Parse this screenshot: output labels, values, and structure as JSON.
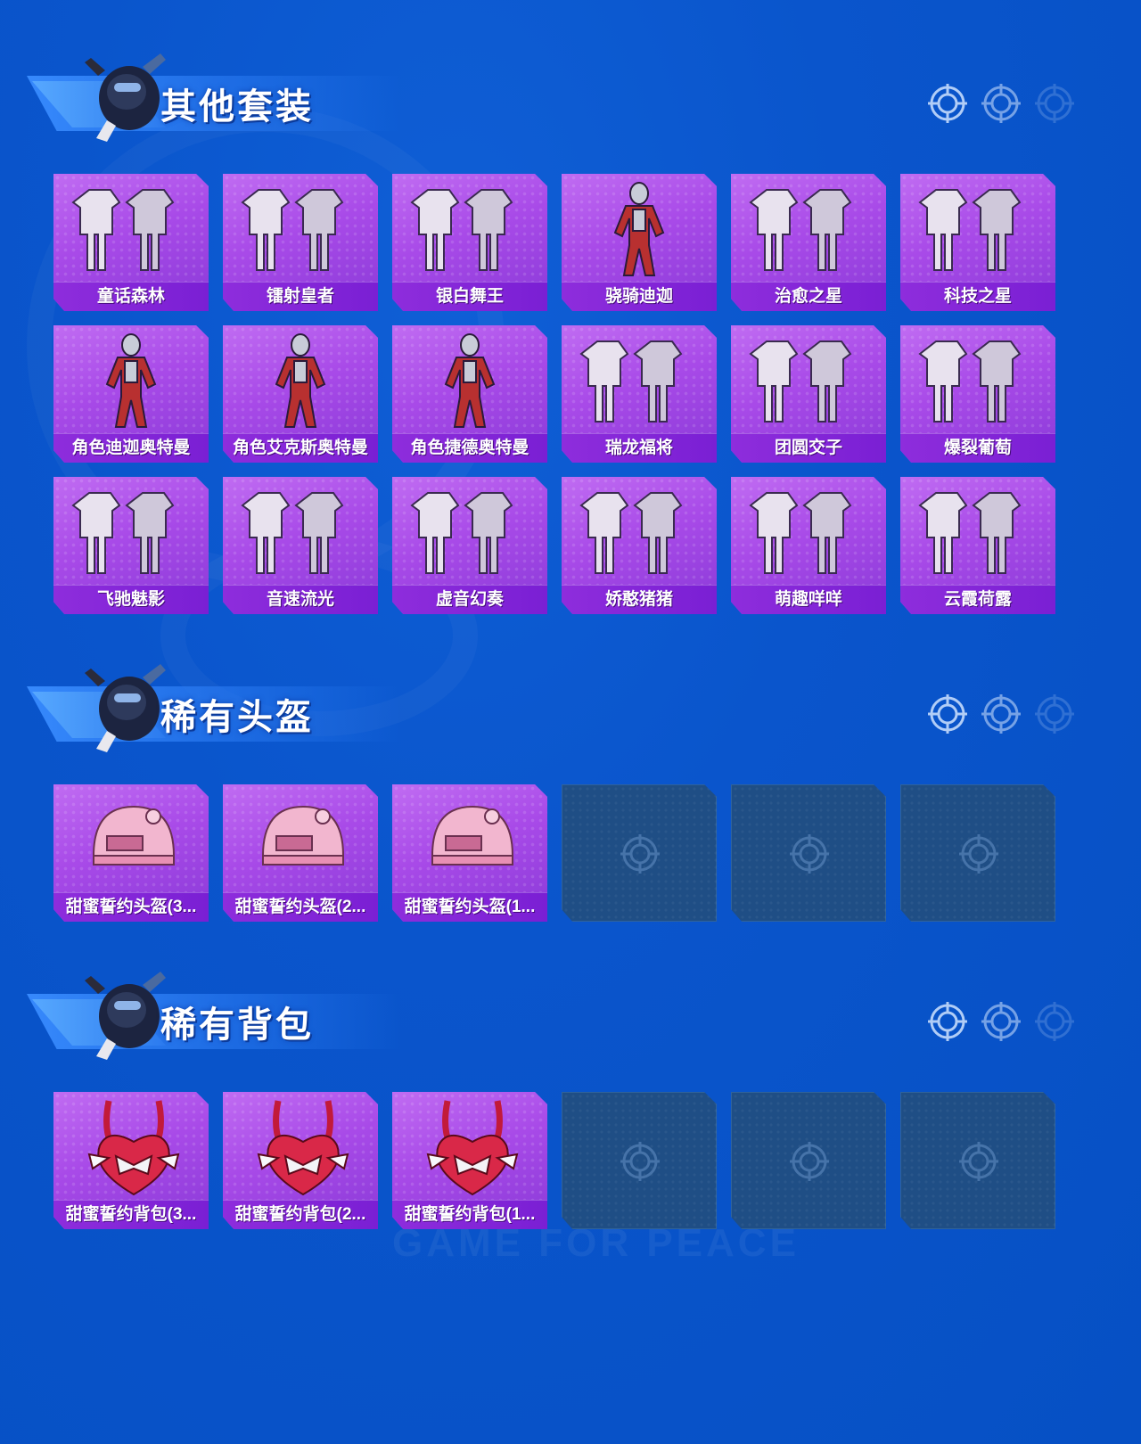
{
  "colors": {
    "background": "#0a55cc",
    "card_purple": "#a84ae8",
    "label_purple": "#8e2ddc",
    "empty_slot": "#1f4e85"
  },
  "watermark": "GAME FOR PEACE",
  "sections": [
    {
      "title": "其他套装",
      "items": [
        {
          "label": "童话森林",
          "art": "outfit-pair-icon"
        },
        {
          "label": "镭射皇者",
          "art": "outfit-pair-icon"
        },
        {
          "label": "银白舞王",
          "art": "outfit-pair-icon"
        },
        {
          "label": "骁骑迪迦",
          "art": "hero-figure-icon"
        },
        {
          "label": "治愈之星",
          "art": "outfit-pair-icon"
        },
        {
          "label": "科技之星",
          "art": "outfit-pair-icon"
        },
        {
          "label": "角色迪迦奥特曼",
          "art": "hero-figure-icon"
        },
        {
          "label": "角色艾克斯奥特曼",
          "art": "hero-figure-icon"
        },
        {
          "label": "角色捷德奥特曼",
          "art": "hero-figure-icon"
        },
        {
          "label": "瑞龙福将",
          "art": "outfit-pair-icon"
        },
        {
          "label": "团圆交子",
          "art": "outfit-pair-icon"
        },
        {
          "label": "爆裂葡萄",
          "art": "outfit-pair-icon"
        },
        {
          "label": "飞驰魅影",
          "art": "outfit-pair-icon"
        },
        {
          "label": "音速流光",
          "art": "outfit-pair-icon"
        },
        {
          "label": "虚音幻奏",
          "art": "outfit-pair-icon"
        },
        {
          "label": "娇憨猪猪",
          "art": "outfit-pair-icon"
        },
        {
          "label": "萌趣咩咩",
          "art": "outfit-pair-icon"
        },
        {
          "label": "云霞荷露",
          "art": "outfit-pair-icon"
        }
      ]
    },
    {
      "title": "稀有头盔",
      "items": [
        {
          "label": "甜蜜誓约头盔(3...",
          "art": "helmet-icon"
        },
        {
          "label": "甜蜜誓约头盔(2...",
          "art": "helmet-icon"
        },
        {
          "label": "甜蜜誓约头盔(1...",
          "art": "helmet-icon"
        },
        {
          "label": "",
          "art": "empty"
        },
        {
          "label": "",
          "art": "empty"
        },
        {
          "label": "",
          "art": "empty"
        }
      ]
    },
    {
      "title": "稀有背包",
      "items": [
        {
          "label": "甜蜜誓约背包(3...",
          "art": "backpack-icon"
        },
        {
          "label": "甜蜜誓约背包(2...",
          "art": "backpack-icon"
        },
        {
          "label": "甜蜜誓约背包(1...",
          "art": "backpack-icon"
        },
        {
          "label": "",
          "art": "empty"
        },
        {
          "label": "",
          "art": "empty"
        },
        {
          "label": "",
          "art": "empty"
        }
      ]
    }
  ]
}
